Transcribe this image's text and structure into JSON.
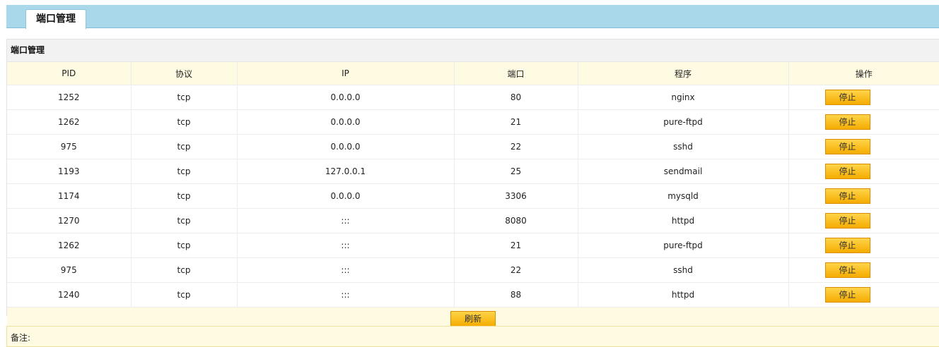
{
  "tab": {
    "label": "端口管理"
  },
  "panel": {
    "title": "端口管理"
  },
  "table": {
    "headers": [
      "PID",
      "协议",
      "IP",
      "端口",
      "程序",
      "操作"
    ],
    "rows": [
      {
        "pid": "1252",
        "protocol": "tcp",
        "ip": "0.0.0.0",
        "port": "80",
        "program": "nginx",
        "action": "停止"
      },
      {
        "pid": "1262",
        "protocol": "tcp",
        "ip": "0.0.0.0",
        "port": "21",
        "program": "pure-ftpd",
        "action": "停止"
      },
      {
        "pid": "975",
        "protocol": "tcp",
        "ip": "0.0.0.0",
        "port": "22",
        "program": "sshd",
        "action": "停止"
      },
      {
        "pid": "1193",
        "protocol": "tcp",
        "ip": "127.0.0.1",
        "port": "25",
        "program": "sendmail",
        "action": "停止"
      },
      {
        "pid": "1174",
        "protocol": "tcp",
        "ip": "0.0.0.0",
        "port": "3306",
        "program": "mysqld",
        "action": "停止"
      },
      {
        "pid": "1270",
        "protocol": "tcp",
        "ip": ":::",
        "port": "8080",
        "program": "httpd",
        "action": "停止"
      },
      {
        "pid": "1262",
        "protocol": "tcp",
        "ip": ":::",
        "port": "21",
        "program": "pure-ftpd",
        "action": "停止"
      },
      {
        "pid": "975",
        "protocol": "tcp",
        "ip": ":::",
        "port": "22",
        "program": "sshd",
        "action": "停止"
      },
      {
        "pid": "1240",
        "protocol": "tcp",
        "ip": ":::",
        "port": "88",
        "program": "httpd",
        "action": "停止"
      }
    ]
  },
  "refresh_button": {
    "label": "刷新"
  },
  "note": {
    "label": "备注:"
  }
}
